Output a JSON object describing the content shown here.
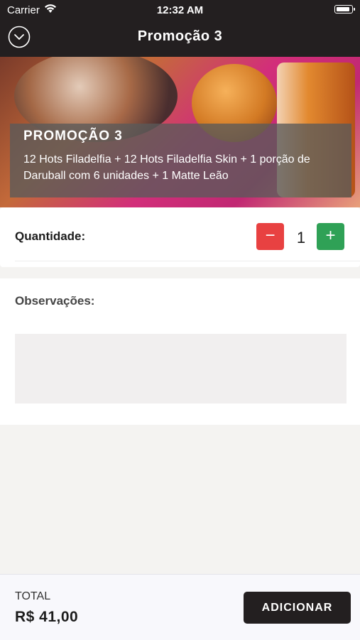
{
  "status_bar": {
    "carrier": "Carrier",
    "time": "12:32 AM",
    "battery_level": 1.0
  },
  "nav": {
    "title": "Promoção 3",
    "back_icon": "chevron-down-circle-icon"
  },
  "product": {
    "name": "PROMOÇÃO 3",
    "description": "12 Hots Filadelfia + 12 Hots Filadelfia Skin + 1 porção de Daruball com 6 unidades + 1 Matte Leão"
  },
  "quantity": {
    "label": "Quantidade:",
    "value": "1",
    "minus_label": "−",
    "plus_label": "+",
    "minus_color": "#e84141",
    "plus_color": "#2fa156"
  },
  "observations": {
    "label": "Observações:",
    "value": ""
  },
  "footer": {
    "total_label": "TOTAL",
    "total_value": "R$ 41,00",
    "add_button_label": "ADICIONAR"
  },
  "colors": {
    "header_bg": "#231f20",
    "page_bg": "#f4f3f1"
  }
}
